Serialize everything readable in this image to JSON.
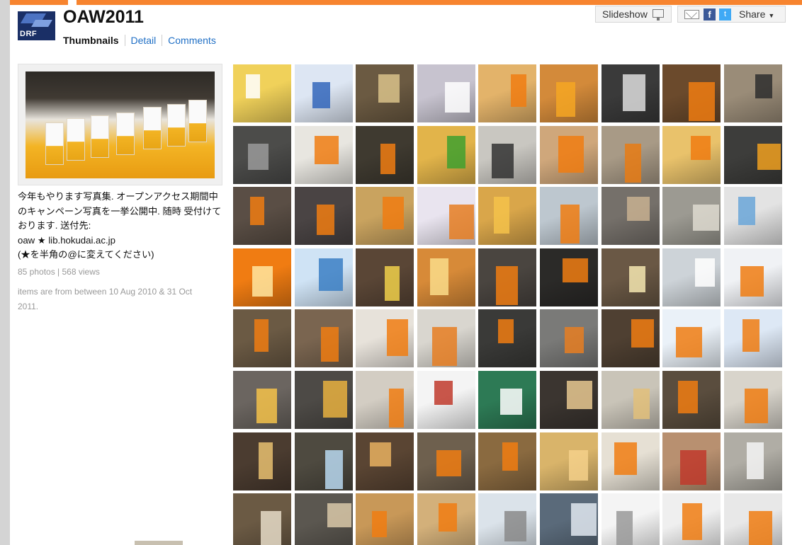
{
  "album": {
    "title": "OAW2011",
    "logo_text": "DRF"
  },
  "subnav": {
    "thumbnails": "Thumbnails",
    "detail": "Detail",
    "comments": "Comments"
  },
  "toolbar": {
    "slideshow": "Slideshow",
    "share": "Share",
    "facebook": "f",
    "twitter": "t"
  },
  "sidebar": {
    "description": [
      "今年もやります写真集. オープンアクセス期間中",
      "のキャンペーン写真を一挙公開中. 随時 受付けて",
      "おります. 送付先:",
      "oaw  ★  lib.hokudai.ac.jp",
      "(★を半角の@に変えてください)"
    ],
    "stats": "85 photos | 568 views",
    "date_range": "items are from between 10 Aug 2010 & 31 Oct 2011."
  },
  "photos": [
    {
      "bg": "#f0d15a",
      "fg": "#ffffff"
    },
    {
      "bg": "#dde6f3",
      "fg": "#3366bb"
    },
    {
      "bg": "#6b5a42",
      "fg": "#d9c28a"
    },
    {
      "bg": "#c7c3cf",
      "fg": "#ffffff"
    },
    {
      "bg": "#e3b36a",
      "fg": "#f07c12"
    },
    {
      "bg": "#d38a3a",
      "fg": "#f5a623"
    },
    {
      "bg": "#3a3a3a",
      "fg": "#dddddd"
    },
    {
      "bg": "#6b4a2c",
      "fg": "#f07c12"
    },
    {
      "bg": "#9a8c78",
      "fg": "#2e2e2e"
    },
    {
      "bg": "#4c4c4a",
      "fg": "#9a9a9a"
    },
    {
      "bg": "#e8e6e0",
      "fg": "#f07c12"
    },
    {
      "bg": "#3f3a30",
      "fg": "#f07c12"
    },
    {
      "bg": "#e2b44a",
      "fg": "#3fa02f"
    },
    {
      "bg": "#c9c7c1",
      "fg": "#333333"
    },
    {
      "bg": "#cfa77b",
      "fg": "#f07c12"
    },
    {
      "bg": "#a89a86",
      "fg": "#e87b14"
    },
    {
      "bg": "#e9c26b",
      "fg": "#f07c12"
    },
    {
      "bg": "#3d3d3b",
      "fg": "#f0a020"
    },
    {
      "bg": "#5a4e45",
      "fg": "#f07c12"
    },
    {
      "bg": "#4a4444",
      "fg": "#f07c12"
    },
    {
      "bg": "#c9a35f",
      "fg": "#f07c12"
    },
    {
      "bg": "#e9e4ef",
      "fg": "#e67e22"
    },
    {
      "bg": "#d9a64a",
      "fg": "#f5c24a"
    },
    {
      "bg": "#bdc7cf",
      "fg": "#f07c12"
    },
    {
      "bg": "#75706a",
      "fg": "#c8b090"
    },
    {
      "bg": "#9c9a92",
      "fg": "#dedad0"
    },
    {
      "bg": "#e3e3e3",
      "fg": "#6aa6d8"
    },
    {
      "bg": "#f07c12",
      "fg": "#ffe6a0"
    },
    {
      "bg": "#cfe3f5",
      "fg": "#3b7fc4"
    },
    {
      "bg": "#5a4636",
      "fg": "#f0d04a"
    },
    {
      "bg": "#d78a38",
      "fg": "#fadc8a"
    },
    {
      "bg": "#4a4540",
      "fg": "#f07c12"
    },
    {
      "bg": "#2b2a28",
      "fg": "#f07c12"
    },
    {
      "bg": "#6a5845",
      "fg": "#f5e6b0"
    },
    {
      "bg": "#cdd3d8",
      "fg": "#ffffff"
    },
    {
      "bg": "#f0f2f5",
      "fg": "#f07c12"
    },
    {
      "bg": "#6b5a44",
      "fg": "#f07c12"
    },
    {
      "bg": "#7a6550",
      "fg": "#f07c12"
    },
    {
      "bg": "#e7e2da",
      "fg": "#f07c12"
    },
    {
      "bg": "#d9d6cf",
      "fg": "#e67e22"
    },
    {
      "bg": "#3a3a38",
      "fg": "#f07c12"
    },
    {
      "bg": "#7a7a78",
      "fg": "#e67e22"
    },
    {
      "bg": "#4f4032",
      "fg": "#f07c12"
    },
    {
      "bg": "#eaf1f8",
      "fg": "#f07c12"
    },
    {
      "bg": "#dde8f5",
      "fg": "#f07c12"
    },
    {
      "bg": "#6b6560",
      "fg": "#f5c24a"
    },
    {
      "bg": "#4d4a46",
      "fg": "#e8b040"
    },
    {
      "bg": "#d3cdc3",
      "fg": "#f07c12"
    },
    {
      "bg": "#f4f4f4",
      "fg": "#c0392b"
    },
    {
      "bg": "#2d7a55",
      "fg": "#ffffff"
    },
    {
      "bg": "#3b3530",
      "fg": "#e8c890"
    },
    {
      "bg": "#c9c4b8",
      "fg": "#e2c07a"
    },
    {
      "bg": "#5a4d3e",
      "fg": "#f07c12"
    },
    {
      "bg": "#d8d4cb",
      "fg": "#f07c12"
    },
    {
      "bg": "#4b3c30",
      "fg": "#e8c070"
    },
    {
      "bg": "#4e4a40",
      "fg": "#b8d8f0"
    },
    {
      "bg": "#5a4533",
      "fg": "#e8b060"
    },
    {
      "bg": "#6e604e",
      "fg": "#f07c12"
    },
    {
      "bg": "#8a6a40",
      "fg": "#f07c12"
    },
    {
      "bg": "#d9b46a",
      "fg": "#f5d08a"
    },
    {
      "bg": "#e6e0d4",
      "fg": "#f07c12"
    },
    {
      "bg": "#b89070",
      "fg": "#c0392b"
    },
    {
      "bg": "#b0ada5",
      "fg": "#f4f4f4"
    },
    {
      "bg": "#6b5a44",
      "fg": "#e6dcc8"
    },
    {
      "bg": "#5b5750",
      "fg": "#d9c8a8"
    },
    {
      "bg": "#c89858",
      "fg": "#f07c12"
    },
    {
      "bg": "#d3b07a",
      "fg": "#f07c12"
    },
    {
      "bg": "#dbe3ea",
      "fg": "#8a8a8a"
    },
    {
      "bg": "#5a6a7a",
      "fg": "#e0e8f0"
    },
    {
      "bg": "#f4f4f4",
      "fg": "#999999"
    },
    {
      "bg": "#efefef",
      "fg": "#f07c12"
    },
    {
      "bg": "#e8e8e8",
      "fg": "#f07c12"
    }
  ]
}
